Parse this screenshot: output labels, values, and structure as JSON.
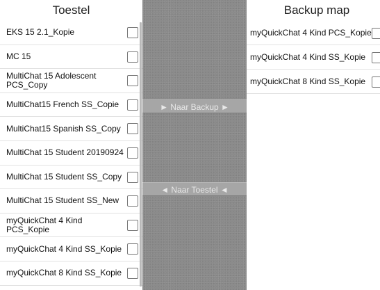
{
  "left": {
    "title": "Toestel",
    "items": [
      {
        "label": "EKS 15 2.1_Kopie"
      },
      {
        "label": "MC 15"
      },
      {
        "label": "MultiChat 15 Adolescent PCS_Copy"
      },
      {
        "label": "MultiChat15 French SS_Copie"
      },
      {
        "label": "MultiChat15 Spanish SS_Copy"
      },
      {
        "label": "MultiChat 15 Student 20190924"
      },
      {
        "label": "MultiChat 15 Student SS_Copy"
      },
      {
        "label": "MultiChat 15 Student SS_New"
      },
      {
        "label": "myQuickChat 4 Kind PCS_Kopie"
      },
      {
        "label": "myQuickChat 4 Kind SS_Kopie"
      },
      {
        "label": "myQuickChat 8 Kind SS_Kopie"
      }
    ]
  },
  "middle": {
    "to_backup_label": "► Naar Backup ►",
    "to_device_label": "◄ Naar Toestel ◄"
  },
  "right": {
    "title": "Backup map",
    "items": [
      {
        "label": "myQuickChat 4 Kind PCS_Kopie"
      },
      {
        "label": "myQuickChat 4 Kind SS_Kopie"
      },
      {
        "label": "myQuickChat 8 Kind SS_Kopie"
      }
    ]
  }
}
